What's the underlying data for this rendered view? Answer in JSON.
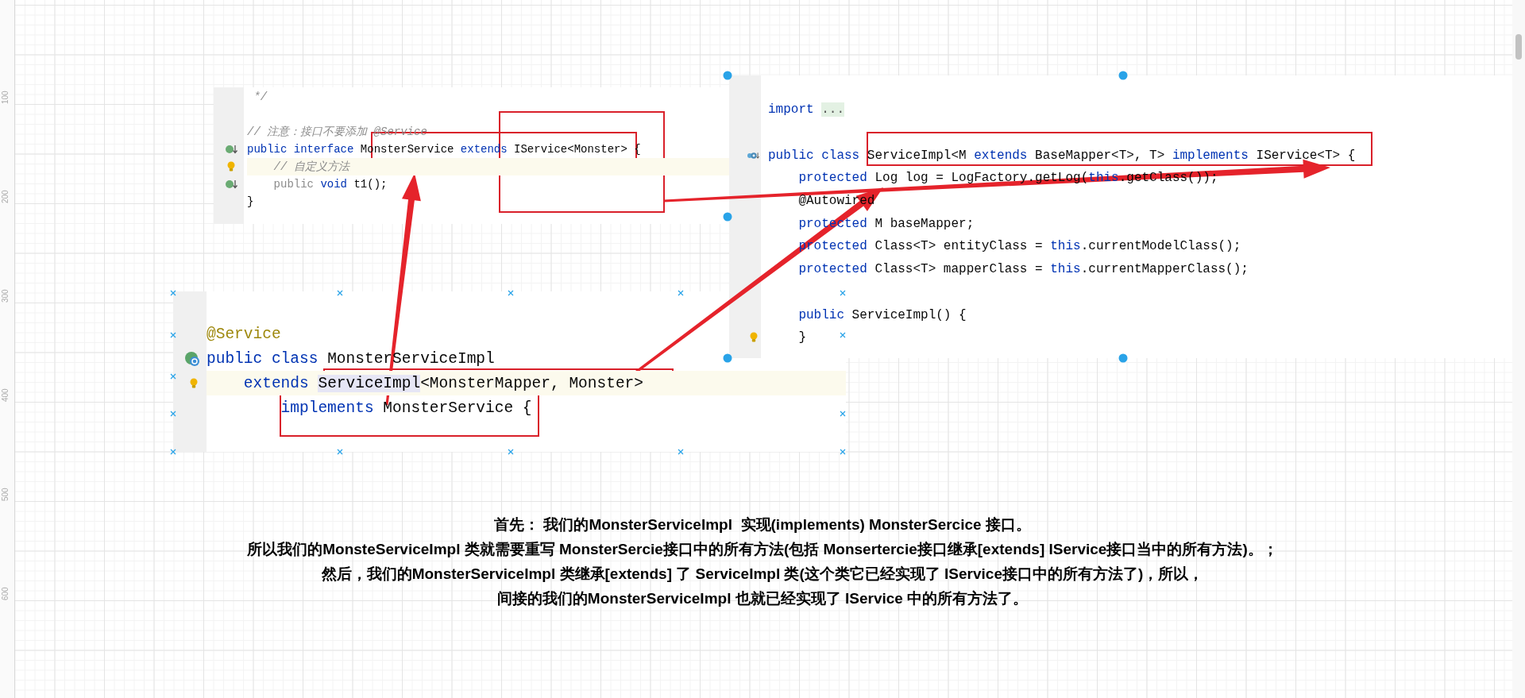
{
  "ruler": {
    "labels": [
      "100",
      "200",
      "300",
      "400",
      "500",
      "600"
    ]
  },
  "panels": [
    {
      "kind": "interface",
      "lines": [
        {
          "kind": "plain",
          "tokens": [
            {
              "text": " */",
              "kind": "comment"
            }
          ]
        },
        {
          "kind": "plain",
          "space_before": true,
          "tokens": [
            {
              "text": "// 注意：接口不要添加 @Service",
              "kind": "comment"
            }
          ]
        },
        {
          "kind": "implemented",
          "tokens": [
            {
              "text": "public interface",
              "kind": "keyword"
            },
            {
              "text": " MonsterService ",
              "kind": "plain"
            },
            {
              "text": "extends",
              "kind": "keyword"
            },
            {
              "text": " IService<Monster> {",
              "kind": "plain"
            }
          ]
        },
        {
          "kind": "bulb",
          "highlighted": true,
          "tokens": [
            {
              "text": "    // 自定义方法",
              "kind": "comment"
            }
          ]
        },
        {
          "kind": "implemented",
          "tokens": [
            {
              "text": "    public",
              "kind": "muted"
            },
            {
              "text": " void",
              "kind": "keyword"
            },
            {
              "text": " t1();",
              "kind": "plain"
            }
          ]
        },
        {
          "kind": "plain",
          "tokens": [
            {
              "text": "}",
              "kind": "plain"
            }
          ]
        }
      ]
    },
    {
      "kind": "impl",
      "lines": [
        {
          "kind": "plain",
          "tokens": [
            {
              "text": "@Service",
              "kind": "annotation"
            }
          ]
        },
        {
          "kind": "class",
          "tokens": [
            {
              "text": "public class",
              "kind": "keyword"
            },
            {
              "text": " MonsterServiceImpl",
              "kind": "plain"
            }
          ]
        },
        {
          "kind": "bulb",
          "highlighted": true,
          "tokens": [
            {
              "text": "    extends ",
              "kind": "keyword"
            },
            {
              "text": "ServiceImpl",
              "kind": "selection"
            },
            {
              "text": "<MonsterMapper, Monster>",
              "kind": "plain"
            }
          ]
        },
        {
          "kind": "plain",
          "tokens": [
            {
              "text": "        implements",
              "kind": "keyword"
            },
            {
              "text": " MonsterService {",
              "kind": "plain"
            }
          ]
        }
      ]
    },
    {
      "kind": "base",
      "lines": [
        {
          "kind": "plain",
          "tokens": [
            {
              "text": "import ",
              "kind": "keyword"
            },
            {
              "text": "...",
              "kind": "folded"
            }
          ]
        },
        {
          "kind": "implementing",
          "space_before": true,
          "tokens": [
            {
              "text": "public class",
              "kind": "keyword"
            },
            {
              "text": " ServiceImpl<M ",
              "kind": "plain"
            },
            {
              "text": "extends",
              "kind": "keyword"
            },
            {
              "text": " BaseMapper<T>, T> ",
              "kind": "plain"
            },
            {
              "text": "implements",
              "kind": "keyword"
            },
            {
              "text": " IService<T> {",
              "kind": "plain"
            }
          ]
        },
        {
          "kind": "plain",
          "tokens": [
            {
              "text": "    protected",
              "kind": "keyword"
            },
            {
              "text": " Log log = LogFactory.getLog(",
              "kind": "plain"
            },
            {
              "text": "this",
              "kind": "keyword"
            },
            {
              "text": ".getClass());",
              "kind": "plain"
            }
          ]
        },
        {
          "kind": "plain",
          "tokens": [
            {
              "text": "    @Autowired",
              "kind": "plain"
            }
          ]
        },
        {
          "kind": "plain",
          "tokens": [
            {
              "text": "    protected",
              "kind": "keyword"
            },
            {
              "text": " M baseMapper;",
              "kind": "plain"
            }
          ]
        },
        {
          "kind": "plain",
          "tokens": [
            {
              "text": "    protected",
              "kind": "keyword"
            },
            {
              "text": " Class<T> entityClass = ",
              "kind": "plain"
            },
            {
              "text": "this",
              "kind": "keyword"
            },
            {
              "text": ".currentModelClass();",
              "kind": "plain"
            }
          ]
        },
        {
          "kind": "plain",
          "tokens": [
            {
              "text": "    protected",
              "kind": "keyword"
            },
            {
              "text": " Class<T> mapperClass = ",
              "kind": "plain"
            },
            {
              "text": "this",
              "kind": "keyword"
            },
            {
              "text": ".currentMapperClass();",
              "kind": "plain"
            }
          ]
        },
        {
          "kind": "plain",
          "space_before": true,
          "tokens": [
            {
              "text": "    public",
              "kind": "keyword"
            },
            {
              "text": " ServiceImpl() {",
              "kind": "plain"
            }
          ]
        },
        {
          "kind": "bulb",
          "tokens": [
            {
              "text": "    }",
              "kind": "plain"
            }
          ]
        }
      ]
    }
  ],
  "explanation": [
    "首先： 我们的MonsterServiceImpl  实现(implements) MonsterSercice 接口。",
    "所以我们的MonsteServiceImpl 类就需要重写 MonsterSercie接口中的所有方法(包括 Monsertercie接口继承[extends] IService接口当中的所有方法)。；",
    "然后，我们的MonsterServiceImpl 类继承[extends] 了 ServiceImpl 类(这个类它已经实现了 IService接口中的所有方法了)，所以，",
    "间接的我们的MonsterServiceImpl 也就已经实现了 IService 中的所有方法了。"
  ]
}
